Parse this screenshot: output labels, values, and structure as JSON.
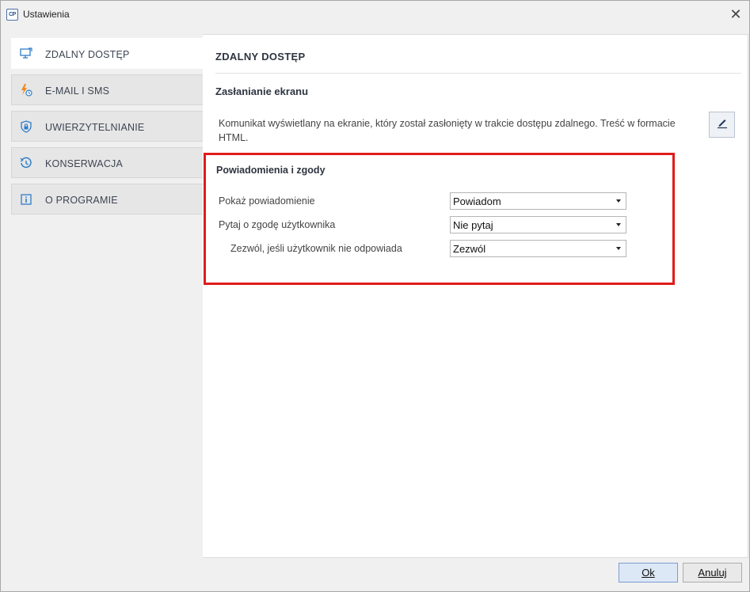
{
  "window": {
    "title": "Ustawienia",
    "app_icon_text": "CP",
    "close_symbol": "✕"
  },
  "sidebar": {
    "items": [
      {
        "label": "ZDALNY DOSTĘP",
        "icon": "monitor-remote-icon",
        "active": true
      },
      {
        "label": "E-MAIL I SMS",
        "icon": "lightning-clock-icon",
        "active": false
      },
      {
        "label": "UWIERZYTELNIANIE",
        "icon": "shield-lock-icon",
        "active": false
      },
      {
        "label": "KONSERWACJA",
        "icon": "history-icon",
        "active": false
      },
      {
        "label": "O PROGRAMIE",
        "icon": "info-icon",
        "active": false
      }
    ]
  },
  "main": {
    "section_title": "ZDALNY DOSTĘP",
    "screen_cover": {
      "title": "Zasłanianie ekranu",
      "description": "Komunikat wyświetlany na ekranie, który został zasłonięty w trakcie dostępu zdalnego. Treść w formacie HTML.",
      "edit_icon": "pencil-icon"
    },
    "notifications": {
      "title": "Powiadomienia i zgody",
      "rows": [
        {
          "label": "Pokaż powiadomienie",
          "value": "Powiadom"
        },
        {
          "label": "Pytaj o zgodę użytkownika",
          "value": "Nie pytaj"
        },
        {
          "label": "Zezwól, jeśli użytkownik nie odpowiada",
          "value": "Zezwól"
        }
      ]
    }
  },
  "footer": {
    "ok_label": "Ok",
    "cancel_label": "Anuluj"
  },
  "colors": {
    "highlight_border": "#e01b1b",
    "accent": "#2f7ec9"
  }
}
